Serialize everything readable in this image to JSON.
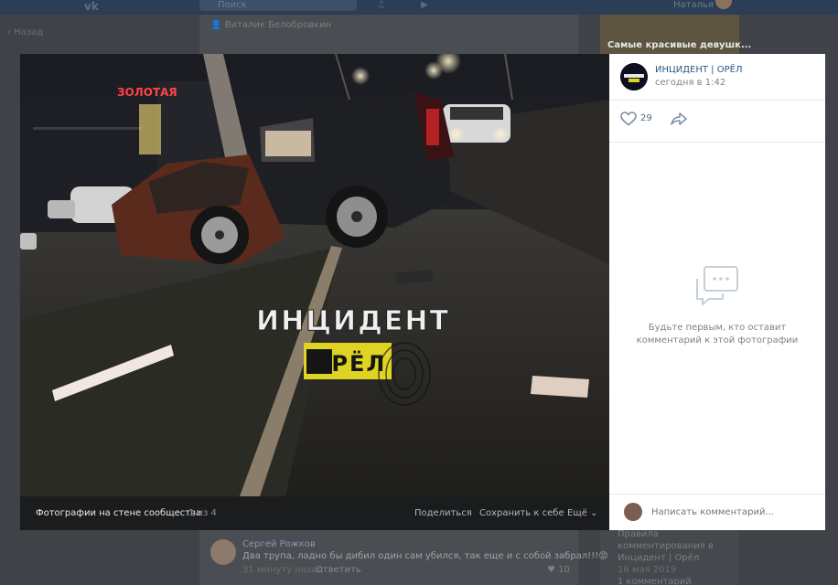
{
  "background": {
    "search_placeholder": "Поиск",
    "user_name": "Наталья",
    "back_label": "Назад",
    "post_author": "Виталик Белобровкин",
    "sidebar_promo_title": "Самые красивые девушк...",
    "rules": {
      "title": "Правила комментирования в Инцидент | Орёл",
      "date": "16 мая 2019",
      "comments": "1 комментарий"
    },
    "comment": {
      "author": "Сергей Рожков",
      "text": "Два трупа, ладно бы дибил один сам убился, так еще и с собой забрал!!!😡",
      "time": "31 минуту назад",
      "reply": "Ответить",
      "likes": "10"
    }
  },
  "photo": {
    "watermark_title": "ИНЦИДЕНТ",
    "watermark_city": "ОРЁЛ",
    "sign_text": "ЗОЛОТАЯ"
  },
  "bottom_bar": {
    "album": "Фотографии на стене сообщества",
    "counter": "1 из 4",
    "share": "Поделиться",
    "save": "Сохранить к себе",
    "more": "Ещё"
  },
  "panel": {
    "group_name": "ИНЦИДЕНТ | ОРЁЛ",
    "date": "сегодня в 1:42",
    "likes": "29",
    "empty_text": "Будьте первым, кто оставит комментарий к этой фотографии",
    "comment_placeholder": "Написать комментарий..."
  },
  "colors": {
    "link": "#2a5885",
    "muted": "#828282",
    "overlay_bg": "#2e3135"
  }
}
